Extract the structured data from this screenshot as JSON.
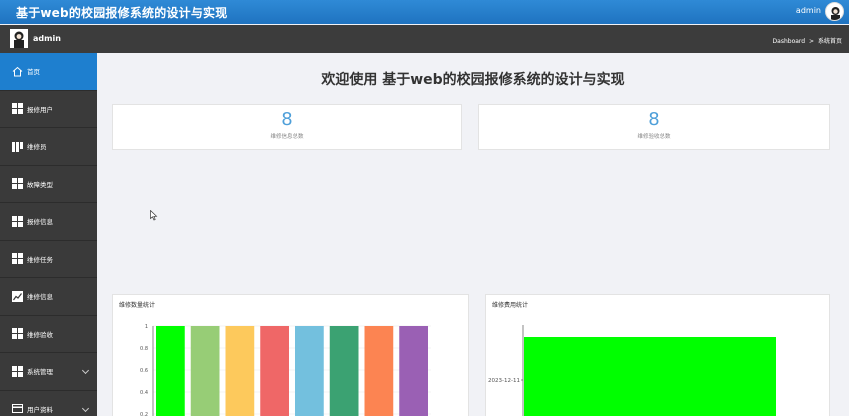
{
  "header": {
    "title": "基于web的校园报修系统的设计与实现",
    "user": "admin"
  },
  "subbar": {
    "user": "admin",
    "breadcrumb": [
      "Dashboard",
      ">",
      "系统首页"
    ]
  },
  "sidebar": {
    "items": [
      {
        "label": "首页",
        "icon": "home-icon"
      },
      {
        "label": "报修用户",
        "icon": "grid-icon"
      },
      {
        "label": "维修员",
        "icon": "book-icon"
      },
      {
        "label": "故障类型",
        "icon": "grid-icon"
      },
      {
        "label": "报修信息",
        "icon": "grid-icon"
      },
      {
        "label": "维修任务",
        "icon": "grid-icon"
      },
      {
        "label": "维修信息",
        "icon": "line-chart-icon"
      },
      {
        "label": "维修验收",
        "icon": "grid-icon"
      },
      {
        "label": "系统管理",
        "icon": "grid-icon"
      },
      {
        "label": "用户资料",
        "icon": "card-icon"
      }
    ]
  },
  "main": {
    "welcome": "欢迎使用 基于web的校园报修系统的设计与实现",
    "stats": [
      {
        "value": "8",
        "label": "维修信息总数"
      },
      {
        "value": "8",
        "label": "维修验收总数"
      }
    ]
  },
  "chart_data": [
    {
      "type": "bar",
      "title": "维修数量统计",
      "yticks": [
        "1",
        "0.8",
        "0.6",
        "0.4",
        "0.2"
      ],
      "values": [
        1,
        1,
        1,
        1,
        1,
        1,
        1,
        1
      ],
      "colors": [
        "#00ff00",
        "#97cd76",
        "#fdc95c",
        "#ef6767",
        "#73c0de",
        "#3ba272",
        "#fc8452",
        "#9a60b4"
      ]
    },
    {
      "type": "bar",
      "title": "维修费用统计",
      "yticks": [
        "2023-12-11"
      ],
      "values": [
        1
      ],
      "colors": [
        "#00ff00"
      ]
    }
  ],
  "colors": {
    "topbar": "#1f73c0",
    "sidebar": "#3a3a3a",
    "active": "#1e7fcf",
    "accent": "#4e9fd9"
  }
}
